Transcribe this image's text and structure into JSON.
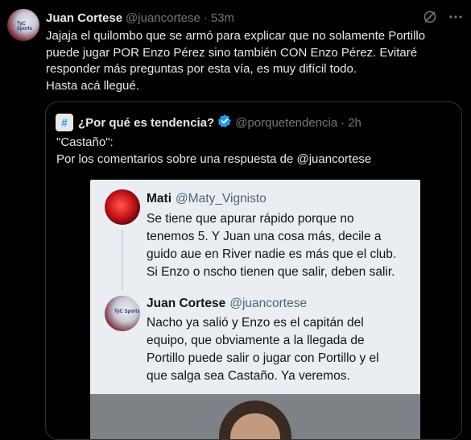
{
  "tweet": {
    "name": "Juan Cortese",
    "handle": "@juancortese",
    "separator": "·",
    "time": "53m",
    "avatar_text": "TyC Sports",
    "text": "Jajaja el quilombo que se armó para explicar que no solamente Portillo\npuede jugar POR Enzo Pérez sino también CON Enzo Pérez. Evitaré\nresponder más preguntas por esta vía, es muy difícil todo.\nHasta acá llegué.",
    "icons": [
      "grok-icon",
      "more-icon"
    ]
  },
  "quote": {
    "name": "¿Por qué es tendencia?",
    "handle": "@porquetendencia",
    "separator": "·",
    "time": "2h",
    "text": "\"Castaño\":\nPor los comentarios sobre una respuesta de @juancortese",
    "image": {
      "reply1": {
        "name": "Mati",
        "handle": "@Maty_Vignisto",
        "text": "Se tiene que apurar rápido porque no\ntenemos 5. Y Juan una cosa más, decile a\nguido aue en River nadie es más que el club.\nSi Enzo o nscho tienen que salir, deben salir."
      },
      "reply2": {
        "name": "Juan Cortese",
        "handle": "@juancortese",
        "avatar_text": "TyC Sports",
        "text": "Nacho ya salió y Enzo es el capitán del\nequipo, que obviamente a la llegada de\nPortillo puede salir o jugar con Portillo y el\nque salga sea Castaño. Ya veremos."
      }
    }
  },
  "colors": {
    "background": "#000000",
    "text": "#e7e9ea",
    "muted": "#71767b",
    "verified": "#1d9bf0",
    "border": "#2f3336"
  }
}
